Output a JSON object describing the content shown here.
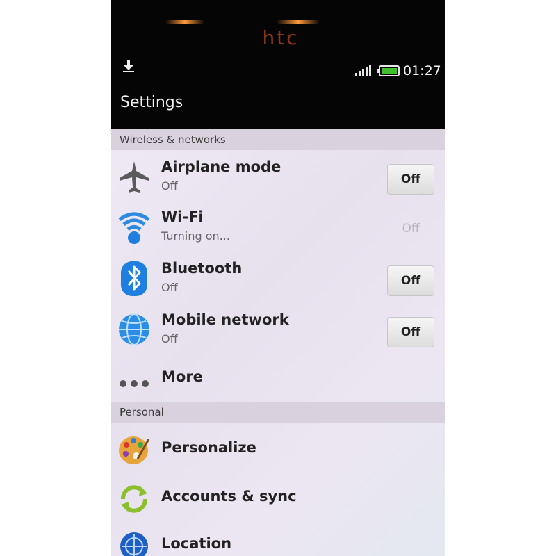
{
  "device": {
    "brand": "htc"
  },
  "status_bar": {
    "time": "01:27",
    "download_icon": "download-icon",
    "signal_icon": "signal-icon",
    "battery_icon": "battery-icon"
  },
  "header": {
    "title": "Settings"
  },
  "sections": [
    {
      "title": "Wireless & networks",
      "items": [
        {
          "label": "Airplane mode",
          "sub": "Off",
          "toggle": "Off",
          "icon": "airplane-icon"
        },
        {
          "label": "Wi-Fi",
          "sub": "Turning on...",
          "toggle": "Off",
          "icon": "wifi-icon",
          "toggle_disabled": true
        },
        {
          "label": "Bluetooth",
          "sub": "Off",
          "toggle": "Off",
          "icon": "bluetooth-icon"
        },
        {
          "label": "Mobile network",
          "sub": "Off",
          "toggle": "Off",
          "icon": "globe-icon"
        },
        {
          "label": "More",
          "icon": "more-icon"
        }
      ]
    },
    {
      "title": "Personal",
      "items": [
        {
          "label": "Personalize",
          "icon": "palette-icon"
        },
        {
          "label": "Accounts & sync",
          "icon": "sync-icon"
        },
        {
          "label": "Location",
          "icon": "location-icon"
        }
      ]
    }
  ],
  "colors": {
    "background": "#e9e4ef",
    "section_header": "#d9d2de",
    "status_bar": "#050505",
    "battery": "#3fbf2a",
    "accent_blue": "#1f7fe0"
  }
}
